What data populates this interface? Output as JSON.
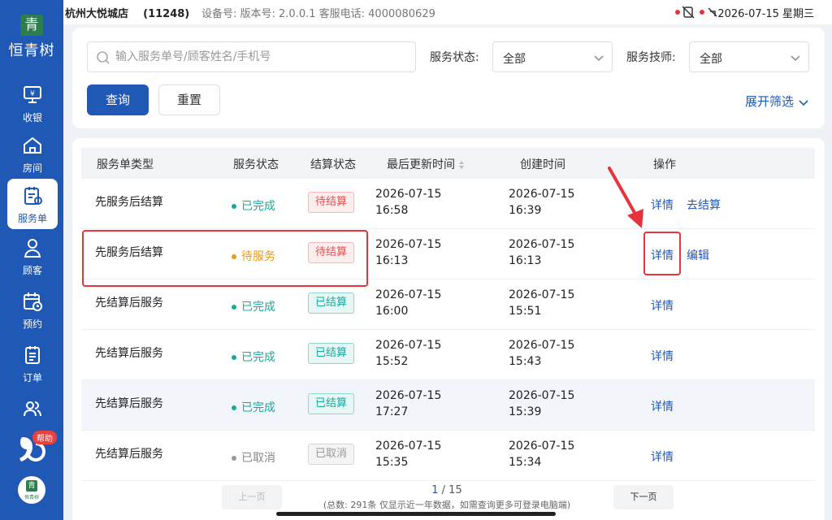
{
  "sidebar": {
    "logo_mark": "青",
    "logo_text": "恒青树",
    "items": [
      {
        "label": "收银",
        "icon": "cash-register-icon"
      },
      {
        "label": "房间",
        "icon": "house-icon"
      },
      {
        "label": "服务单",
        "icon": "service-order-icon",
        "active": true
      },
      {
        "label": "顾客",
        "icon": "user-icon"
      },
      {
        "label": "预约",
        "icon": "calendar-clock-icon"
      },
      {
        "label": "订单",
        "icon": "order-list-icon"
      }
    ],
    "help_badge": "帮助",
    "avatar_text": "恒青树"
  },
  "topbar": {
    "store_name": "杭州大悦城店",
    "store_code": "(11248)",
    "device_info": "设备号: 版本号: 2.0.0.1 客服电话: 4000080629",
    "datetime": "2026-07-15 星期三"
  },
  "filter": {
    "search_placeholder": "输入服务单号/顾客姓名/手机号",
    "service_status_label": "服务状态:",
    "service_status_value": "全部",
    "technician_label": "服务技师:",
    "technician_value": "全部",
    "query_button": "查询",
    "reset_button": "重置",
    "expand_label": "展开筛选"
  },
  "table": {
    "headers": [
      "服务单类型",
      "服务状态",
      "结算状态",
      "最后更新时间",
      "创建时间",
      "操作"
    ],
    "rows": [
      {
        "type": "先服务后结算",
        "status": "已完成",
        "status_kind": "done",
        "settle": "待结算",
        "settle_kind": "pending",
        "updated_date": "2026-07-15",
        "updated_time": "16:58",
        "created_date": "2026-07-15",
        "created_time": "16:39",
        "actions": [
          "详情",
          "去结算"
        ]
      },
      {
        "type": "先服务后结算",
        "status": "待服务",
        "status_kind": "wait",
        "settle": "待结算",
        "settle_kind": "pending",
        "updated_date": "2026-07-15",
        "updated_time": "16:13",
        "created_date": "2026-07-15",
        "created_time": "16:13",
        "actions": [
          "详情",
          "编辑"
        ]
      },
      {
        "type": "先结算后服务",
        "status": "已完成",
        "status_kind": "done",
        "settle": "已结算",
        "settle_kind": "settled",
        "updated_date": "2026-07-15",
        "updated_time": "16:00",
        "created_date": "2026-07-15",
        "created_time": "15:51",
        "actions": [
          "详情"
        ]
      },
      {
        "type": "先结算后服务",
        "status": "已完成",
        "status_kind": "done",
        "settle": "已结算",
        "settle_kind": "settled",
        "updated_date": "2026-07-15",
        "updated_time": "15:52",
        "created_date": "2026-07-15",
        "created_time": "15:43",
        "actions": [
          "详情"
        ]
      },
      {
        "type": "先结算后服务",
        "status": "已完成",
        "status_kind": "done",
        "settle": "已结算",
        "settle_kind": "settled",
        "updated_date": "2026-07-15",
        "updated_time": "17:27",
        "created_date": "2026-07-15",
        "created_time": "15:39",
        "actions": [
          "详情"
        ]
      },
      {
        "type": "先结算后服务",
        "status": "已取消",
        "status_kind": "cancel",
        "settle": "已取消",
        "settle_kind": "cancel",
        "updated_date": "2026-07-15",
        "updated_time": "15:35",
        "created_date": "2026-07-15",
        "created_time": "15:34",
        "actions": [
          "详情"
        ]
      }
    ]
  },
  "pagination": {
    "prev": "上一页",
    "next": "下一页",
    "current": "1",
    "total_pages": "/ 15",
    "summary": "(总数: 291条 仅显示近一年数据，如需查询更多可登录电脑端)"
  },
  "colors": {
    "primary": "#1f58b5",
    "highlight": "#e8323c",
    "done": "#1aa89c",
    "wait": "#e89b1a"
  }
}
